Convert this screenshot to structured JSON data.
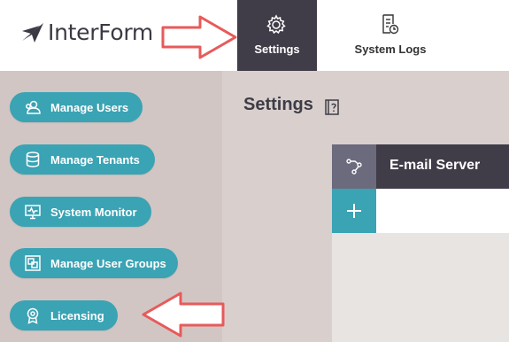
{
  "header": {
    "logo_text": "InterForm",
    "tabs": [
      {
        "label": "Settings",
        "icon": "gear-icon",
        "active": true
      },
      {
        "label": "System Logs",
        "icon": "document-clock-icon",
        "active": false
      }
    ]
  },
  "sidebar": {
    "items": [
      {
        "label": "Manage Users",
        "icon": "users-icon"
      },
      {
        "label": "Manage Tenants",
        "icon": "database-icon"
      },
      {
        "label": "System Monitor",
        "icon": "monitor-icon"
      },
      {
        "label": "Manage User Groups",
        "icon": "groups-icon"
      },
      {
        "label": "Licensing",
        "icon": "badge-icon"
      }
    ]
  },
  "main": {
    "title": "Settings",
    "help_icon": "help-icon",
    "list": [
      {
        "label": "E-mail Server",
        "icon": "flow-icon"
      }
    ],
    "add_icon": "plus-icon"
  },
  "annotations": {
    "arrow_color": "#e85a5a"
  },
  "colors": {
    "accent": "#3aa3b4",
    "dark": "#403c48",
    "sidebar_bg": "#d1c6c4",
    "content_bg": "#d9cfcd"
  }
}
